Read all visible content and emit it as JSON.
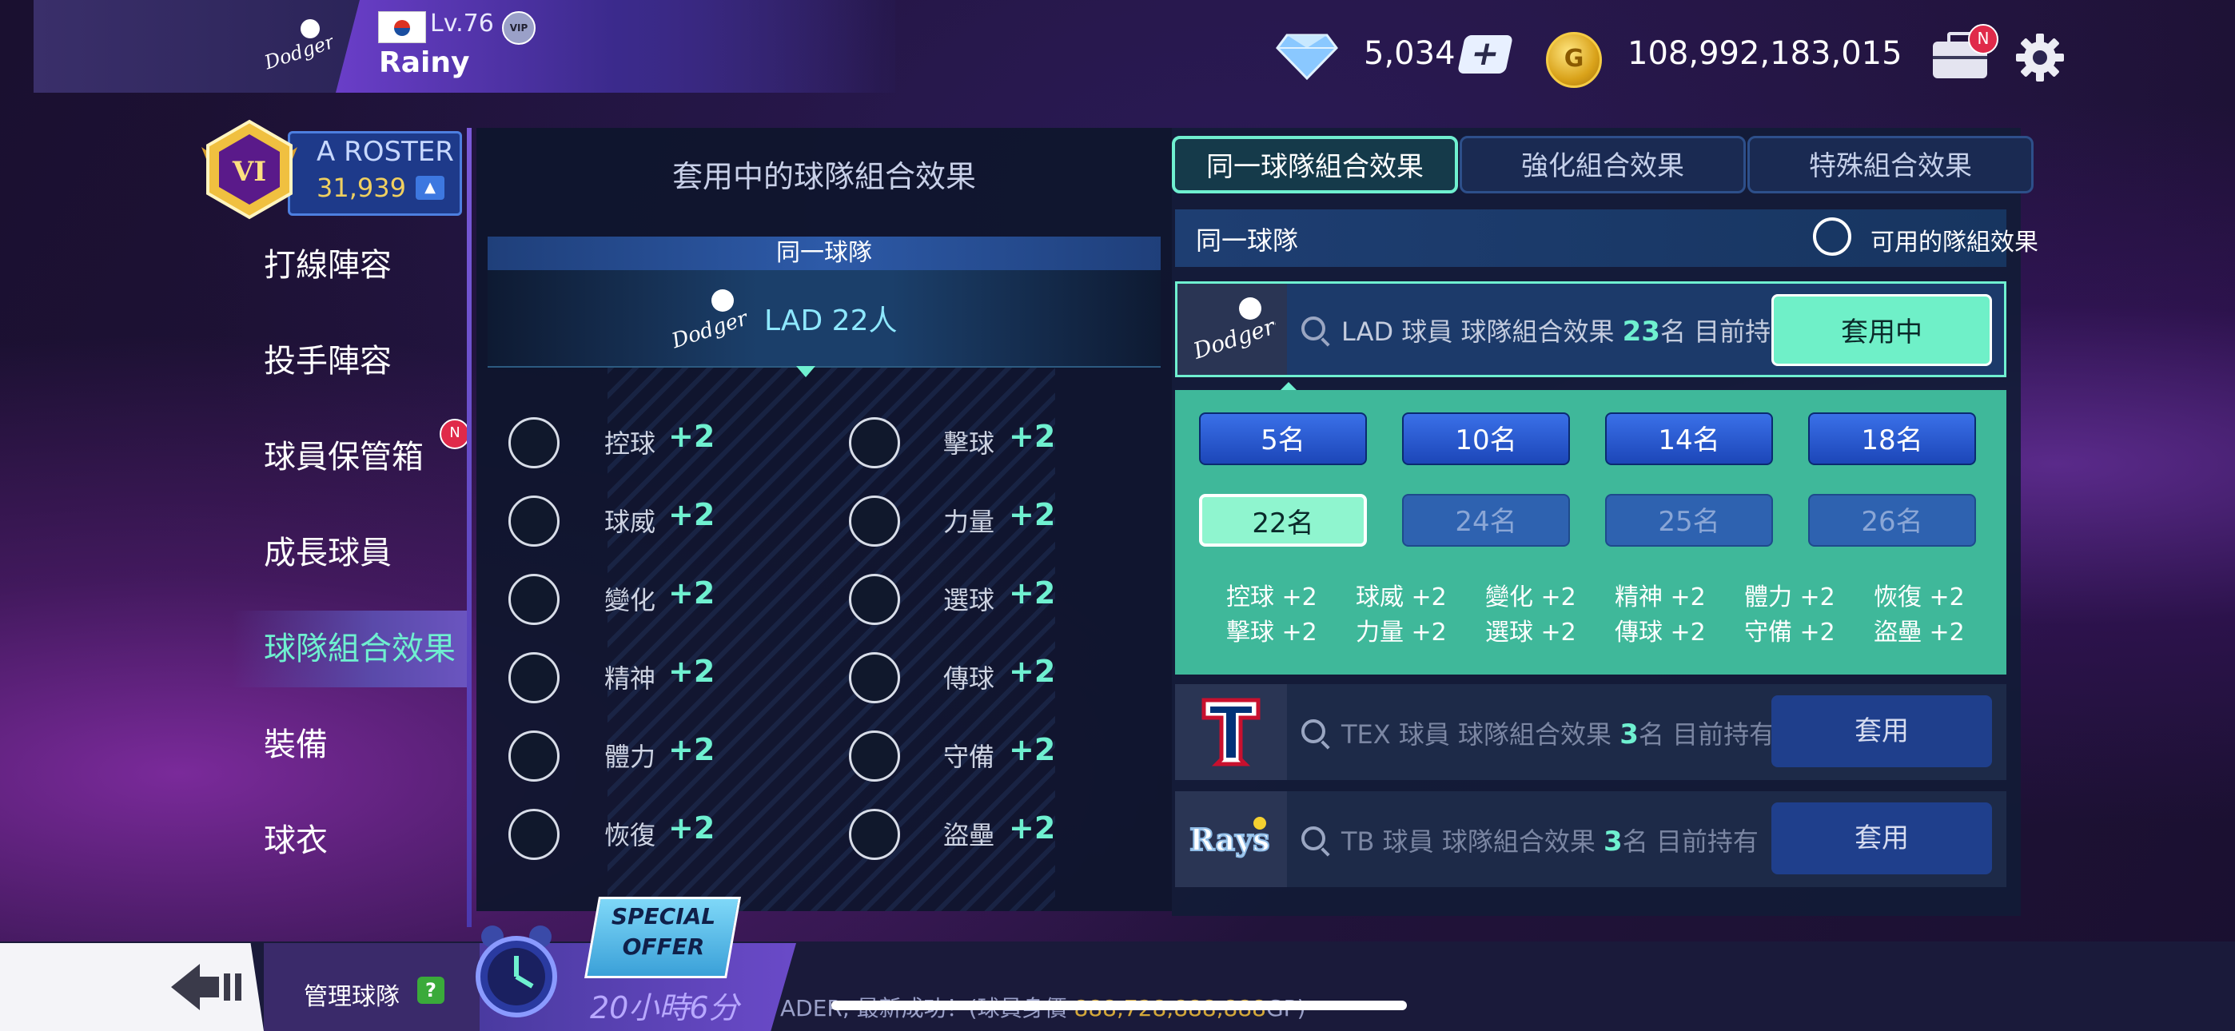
{
  "player": {
    "level": "Lv.76",
    "vip": "VIP",
    "name": "Rainy"
  },
  "currency": {
    "gems": "5,034",
    "coins": "108,992,183,015",
    "coin_symbol": "G"
  },
  "inbox_badge": "N",
  "roster": {
    "rank": "VI",
    "name": "A ROSTER",
    "score": "31,939"
  },
  "nav": {
    "items": [
      "打線陣容",
      "投手陣容",
      "球員保管箱",
      "成長球員",
      "球隊組合效果",
      "裝備",
      "球衣"
    ],
    "badge": "N",
    "active_index": 4
  },
  "applied": {
    "title": "套用中的球隊組合效果",
    "subheader": "同一球隊",
    "team": "LAD 22人",
    "stats": [
      {
        "label": "控球",
        "value": "+2"
      },
      {
        "label": "擊球",
        "value": "+2"
      },
      {
        "label": "球威",
        "value": "+2"
      },
      {
        "label": "力量",
        "value": "+2"
      },
      {
        "label": "變化",
        "value": "+2"
      },
      {
        "label": "選球",
        "value": "+2"
      },
      {
        "label": "精神",
        "value": "+2"
      },
      {
        "label": "傳球",
        "value": "+2"
      },
      {
        "label": "體力",
        "value": "+2"
      },
      {
        "label": "守備",
        "value": "+2"
      },
      {
        "label": "恢復",
        "value": "+2"
      },
      {
        "label": "盜壘",
        "value": "+2"
      }
    ]
  },
  "tabs": [
    "同一球隊組合效果",
    "強化組合效果",
    "特殊組合效果"
  ],
  "filter": {
    "label": "同一球隊",
    "radio_label": "可用的隊組效果"
  },
  "teams": [
    {
      "prefix": "LAD 球員 球隊組合效果",
      "count": "23",
      "suffix": "名 目前持有",
      "button": "套用中",
      "active": true
    },
    {
      "prefix": "TEX 球員 球隊組合效果",
      "count": "3",
      "suffix": "名 目前持有",
      "button": "套用",
      "active": false
    },
    {
      "prefix": "TB 球員 球隊組合效果",
      "count": "3",
      "suffix": "名 目前持有",
      "button": "套用",
      "active": false
    }
  ],
  "tiers": {
    "row1": [
      "5名",
      "10名",
      "14名",
      "18名"
    ],
    "row2": [
      "22名",
      "24名",
      "25名",
      "26名"
    ],
    "stats_row1": [
      "控球 +2",
      "球威 +2",
      "變化 +2",
      "精神 +2",
      "體力 +2",
      "恢復 +2"
    ],
    "stats_row2": [
      "擊球 +2",
      "力量 +2",
      "選球 +2",
      "傳球 +2",
      "守備 +2",
      "盜壘 +2"
    ]
  },
  "bottom": {
    "manage": "管理球隊",
    "help": "?",
    "offer_line1": "SPECIAL",
    "offer_line2": "OFFER",
    "timer": "20小時6分",
    "ticker": "ADER, 最新成功！(球員身價 ",
    "ticker_gold": "888,728,888,888",
    "ticker_end": "GP)"
  },
  "colors": {
    "accent": "#6ff0d0",
    "panel": "#121c36",
    "tier_bg": "#3fb89a",
    "button_blue": "#1f3f8c"
  }
}
